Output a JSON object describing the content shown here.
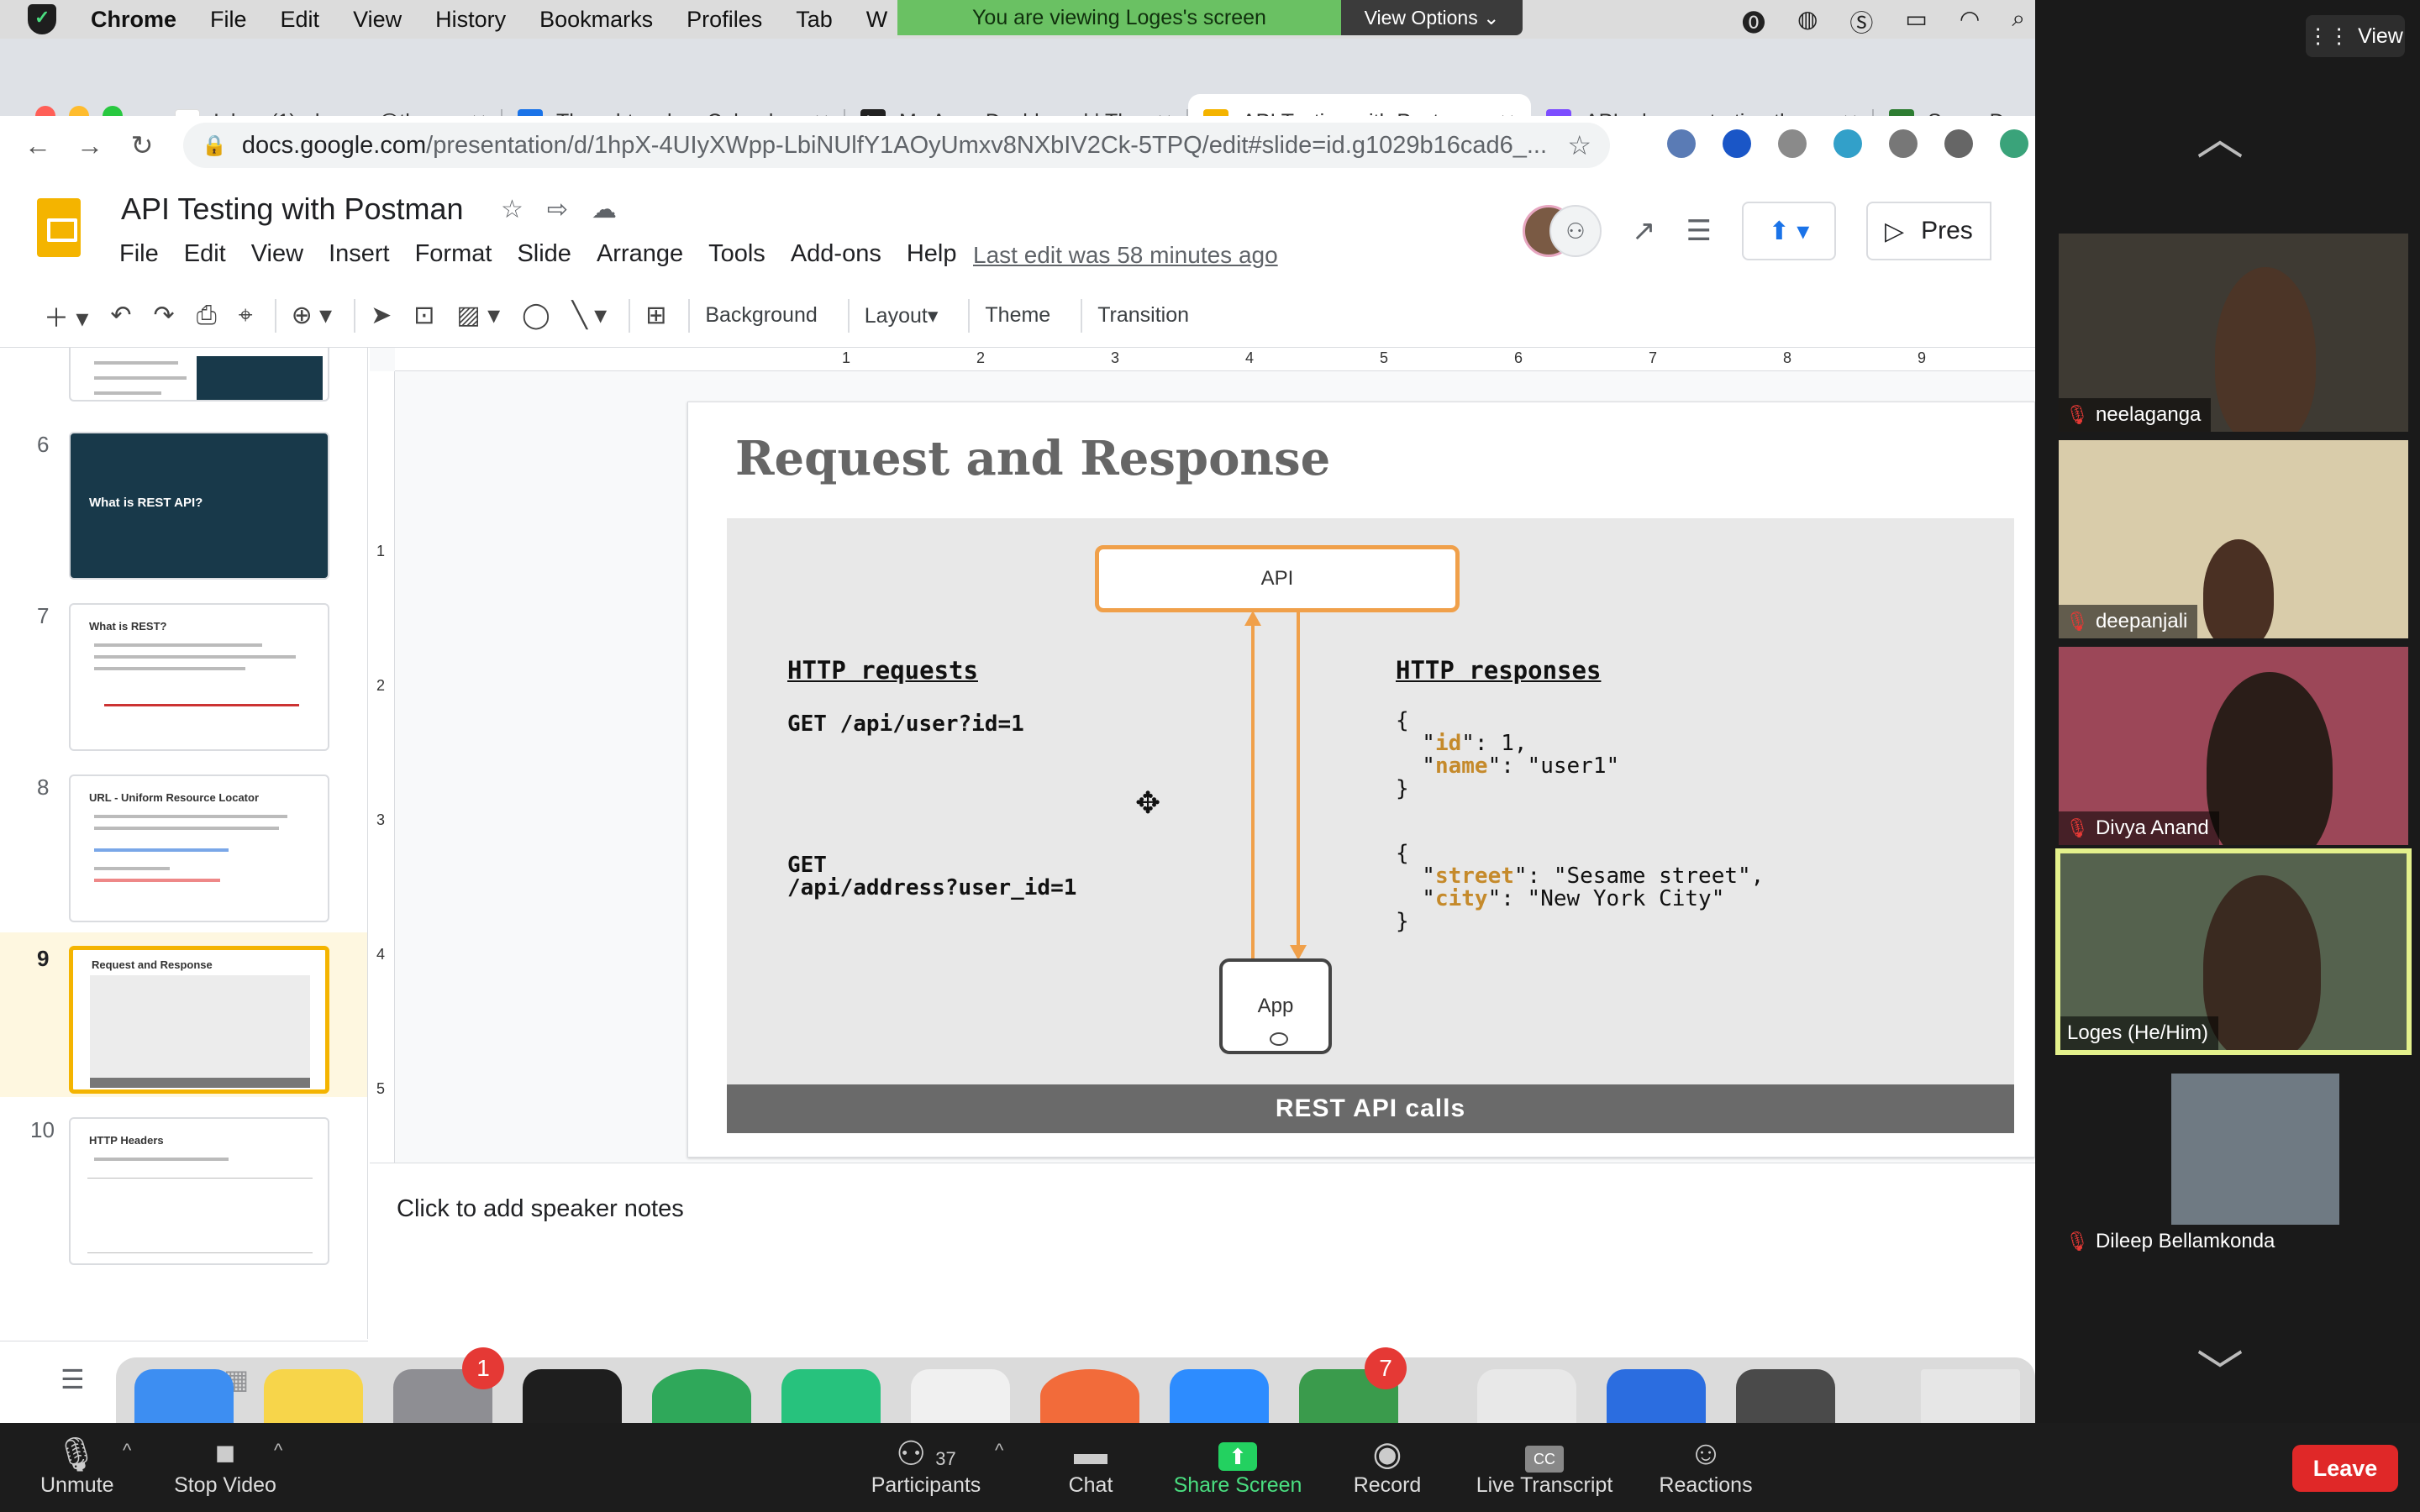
{
  "menubar": {
    "app": "Chrome",
    "items": [
      "File",
      "Edit",
      "View",
      "History",
      "Bookmarks",
      "Profiles",
      "Tab",
      "W"
    ],
    "share_banner": "You are viewing Loges's screen",
    "view_options": "View Options"
  },
  "tabs": [
    {
      "label": "Inbox (1) - loges.r@thoug",
      "icon": "gmail-icon",
      "color": "#d93025"
    },
    {
      "label": "Thoughtworks - Calenda",
      "icon": "calendar-icon",
      "color": "#1a73e8"
    },
    {
      "label": "My Apps Dashboard | Th",
      "icon": "apps-icon",
      "color": "#222222"
    },
    {
      "label": "API Testing with Postmar",
      "icon": "slides-icon",
      "color": "#f4b400"
    },
    {
      "label": "APIs demonstrating the",
      "icon": "document-icon",
      "color": "#7c4dff"
    },
    {
      "label": "Spree Dem",
      "icon": "spree-icon",
      "color": "#2e7d32"
    }
  ],
  "address": {
    "domain": "docs.google.com",
    "path": "/presentation/d/1hpX-4UIyXWpp-LbiNUlfY1AOyUmxv8NXbIV2Ck-5TPQ/edit#slide=id.g1029b16cad6_..."
  },
  "slides_app": {
    "title": "API Testing with Postman",
    "menus": [
      "File",
      "Edit",
      "View",
      "Insert",
      "Format",
      "Slide",
      "Arrange",
      "Tools",
      "Add-ons",
      "Help"
    ],
    "last_edit": "Last edit was 58 minutes ago",
    "present_label": "Pres",
    "toolbar": {
      "background": "Background",
      "layout": "Layout",
      "theme": "Theme",
      "transition": "Transition"
    },
    "speaker_notes": "Click to add speaker notes"
  },
  "filmstrip": [
    {
      "num": "6",
      "title": "What is REST API?"
    },
    {
      "num": "7",
      "title": "What is REST?"
    },
    {
      "num": "8",
      "title": "URL - Uniform Resource Locator"
    },
    {
      "num": "9",
      "title": "Request and Response"
    },
    {
      "num": "10",
      "title": "HTTP Headers"
    }
  ],
  "ruler": {
    "h": [
      "1",
      "2",
      "3",
      "4",
      "5",
      "6",
      "7",
      "8",
      "9"
    ],
    "v": [
      "1",
      "2",
      "3",
      "4",
      "5"
    ]
  },
  "slide": {
    "title": "Request and Response",
    "api_label": "API",
    "app_label": "App",
    "requests_heading": "HTTP requests",
    "request1": "GET /api/user?id=1",
    "request2": "GET\n/api/address?user_id=1",
    "responses_heading": "HTTP responses",
    "footer": "REST API calls"
  },
  "dock": {
    "badge_settings": "1",
    "badge_app": "7"
  },
  "zoom": {
    "view_label": "View",
    "participants": [
      {
        "name": "neelaganga",
        "muted": true
      },
      {
        "name": "deepanjali",
        "muted": true
      },
      {
        "name": "Divya Anand",
        "muted": true
      },
      {
        "name": "Loges  (He/Him)",
        "muted": false,
        "active": true
      },
      {
        "name": "Dileep Bellamkonda",
        "muted": true
      }
    ],
    "bar": {
      "unmute": "Unmute",
      "stop_video": "Stop Video",
      "participants": "Participants",
      "participants_count": "37",
      "chat": "Chat",
      "share_screen": "Share Screen",
      "record": "Record",
      "live_transcript": "Live Transcript",
      "reactions": "Reactions",
      "leave": "Leave"
    }
  }
}
